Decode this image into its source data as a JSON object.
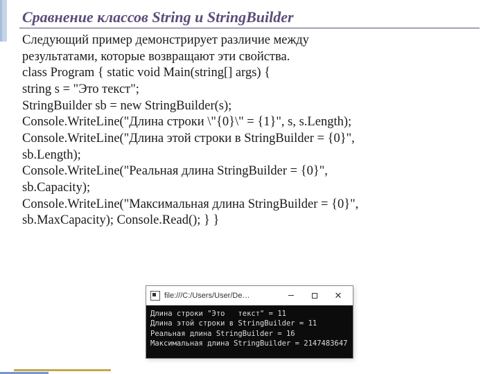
{
  "title": "Сравнение классов String и StringBuilder",
  "body": {
    "l1": "Следующий пример демонстрирует различие между",
    "l2": "результатами, которые возвращают эти свойства.",
    "l3": "class Program {   static void Main(string[] args)   {",
    "l4": "string s = \"Это   текст\";",
    "l5": "StringBuilder sb = new StringBuilder(s);",
    "l6": " Console.WriteLine(\"Длина строки \\\"{0}\\\" = {1}\", s, s.Length);",
    "l7": "Console.WriteLine(\"Длина этой строки в StringBuilder = {0}\",",
    "l8": "sb.Length);",
    "l9": "Console.WriteLine(\"Реальная длина StringBuilder = {0}\",",
    "l10": "sb.Capacity);",
    "l11": "Console.WriteLine(\"Максимальная длина StringBuilder = {0}\",",
    "l12": "sb.MaxCapacity);   Console.Read();  } }"
  },
  "console": {
    "title": "file:///C:/Users/User/De…",
    "out1": "Длина строки \"Это   текст\" = 11",
    "out2": "Длина этой строки в StringBuilder = 11",
    "out3": "Реальная длина StringBuilder = 16",
    "out4": "Максимальная длина StringBuilder = 2147483647"
  }
}
